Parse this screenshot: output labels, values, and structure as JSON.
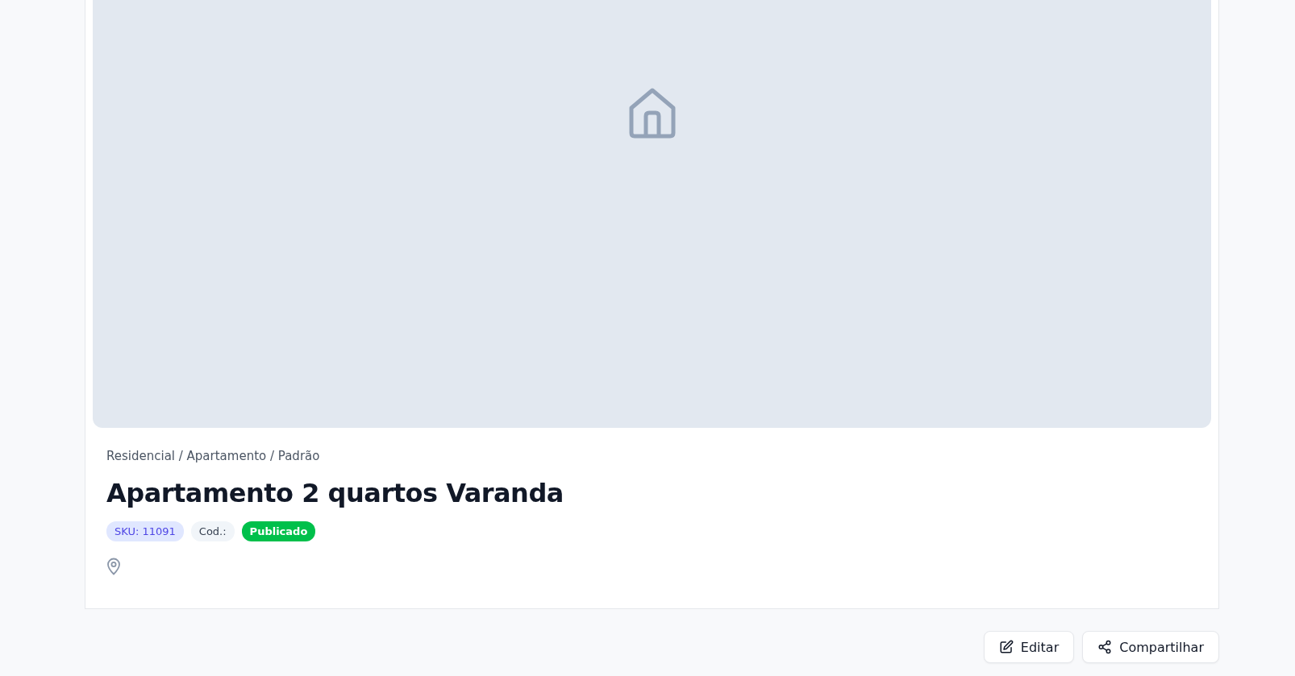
{
  "listing": {
    "breadcrumb": "Residencial / Apartamento / Padrão",
    "title": "Apartamento 2 quartos Varanda",
    "badges": [
      {
        "kind": "info",
        "label": "SKU: 11091"
      },
      {
        "kind": "neutral",
        "label": "Cod.:"
      },
      {
        "kind": "success",
        "label": "Publicado"
      }
    ]
  },
  "actions": [
    {
      "kind": "edit",
      "label": "Editar"
    },
    {
      "kind": "share",
      "label": "Compartilhar"
    }
  ]
}
